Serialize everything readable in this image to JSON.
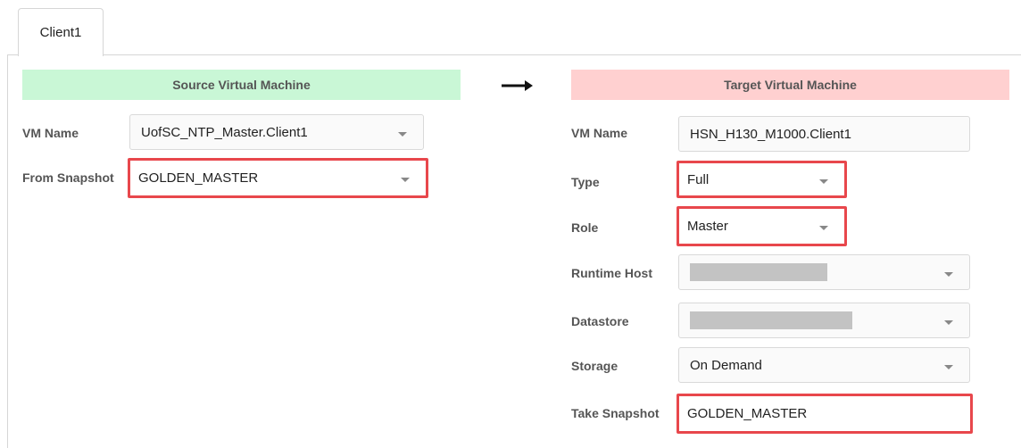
{
  "tab": {
    "label": "Client1"
  },
  "source": {
    "header": "Source Virtual Machine",
    "vm_name_label": "VM Name",
    "vm_name_value": "UofSC_NTP_Master.Client1",
    "snapshot_label": "From Snapshot",
    "snapshot_value": "GOLDEN_MASTER"
  },
  "target": {
    "header": "Target Virtual Machine",
    "vm_name_label": "VM Name",
    "vm_name_value": "HSN_H130_M1000.Client1",
    "type_label": "Type",
    "type_value": "Full",
    "role_label": "Role",
    "role_value": "Master",
    "runtime_host_label": "Runtime Host",
    "datastore_label": "Datastore",
    "storage_label": "Storage",
    "storage_value": "On Demand",
    "take_snapshot_label": "Take Snapshot",
    "take_snapshot_value": "GOLDEN_MASTER"
  },
  "colors": {
    "source_header_bg": "#c9f7d6",
    "target_header_bg": "#ffd0d0",
    "highlight_border": "#e8474c"
  },
  "icons": {
    "arrow": "arrow-right-icon",
    "dropdown": "chevron-down-icon"
  }
}
